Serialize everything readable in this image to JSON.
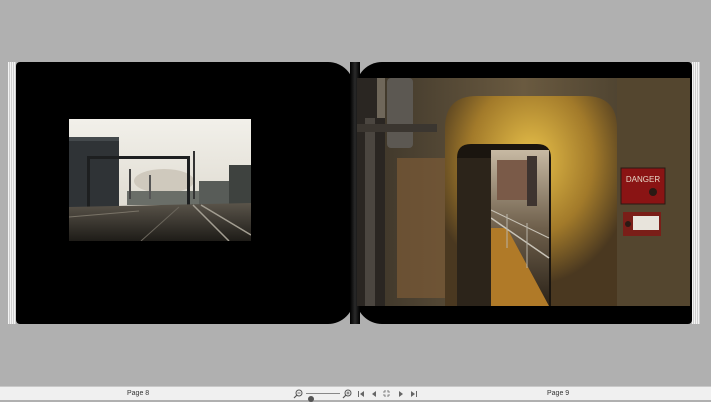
{
  "viewer": {
    "left_page_label": "Page 8",
    "right_page_label": "Page 9",
    "zoom_level": 0.15
  },
  "toolbar_icons": {
    "zoom_out": "zoom-out-icon",
    "zoom_in": "zoom-in-icon",
    "first_page": "first-page-icon",
    "prev_page": "previous-page-icon",
    "fit": "fit-spread-icon",
    "next_page": "next-page-icon",
    "last_page": "last-page-icon"
  },
  "colors": {
    "background": "#b0b0b0",
    "page": "#000000",
    "toolbar": "#f0f0f0",
    "danger_sign": "#8a1414"
  },
  "signs": {
    "danger": "DANGER"
  }
}
